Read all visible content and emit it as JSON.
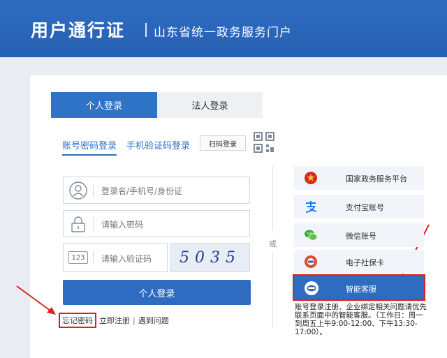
{
  "header": {
    "brand": "用户通行证",
    "portal": "山东省统一政务服务门户"
  },
  "tabs": {
    "personal": "个人登录",
    "legal": "法人登录"
  },
  "login_modes": {
    "account": "账号密码登录",
    "phone": "手机验证码登录",
    "scan": "扫码登录"
  },
  "form": {
    "username_placeholder": "登录名/手机号/身份证",
    "password_placeholder": "请输入密码",
    "code_icon": "123",
    "code_placeholder": "请输入验证码",
    "captcha": "5035",
    "submit": "个人登录"
  },
  "links": {
    "forgot": "忘记密码",
    "register": "立即注册",
    "problem": "遇到问题",
    "separator": "|"
  },
  "divider": "或",
  "alt_logins": [
    {
      "label": "国家政务服务平台",
      "icon": "national-emblem-icon"
    },
    {
      "label": "支付宝账号",
      "icon": "alipay-icon"
    },
    {
      "label": "微信账号",
      "icon": "wechat-icon"
    },
    {
      "label": "电子社保卡",
      "icon": "social-security-card-icon"
    },
    {
      "label": "智能客服",
      "icon": "smart-service-icon"
    }
  ],
  "note": "账号登录注册、企业绑定相关问题请优先联系页面中的智能客服。（工作日：周一到周五上午9:00-12:00、下午13:30-17:00）。",
  "colors": {
    "brand_blue": "#2f6cc0",
    "highlight_red": "#e02020"
  }
}
